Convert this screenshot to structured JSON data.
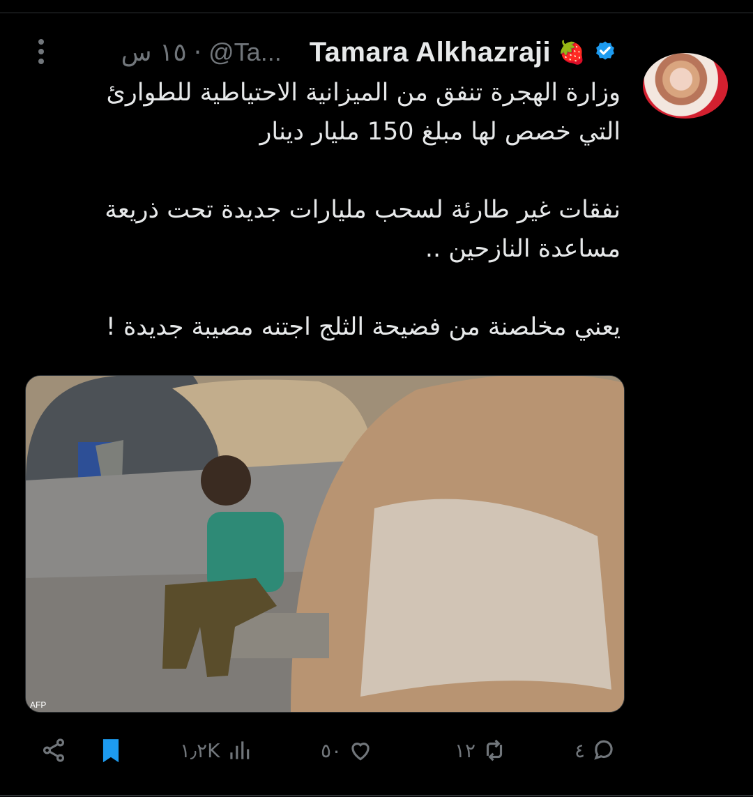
{
  "tweet": {
    "display_name": "Tamara Alkhazraji",
    "emoji": "🍓",
    "handle": "@Ta...",
    "time": "١٥ س",
    "separator": "·",
    "text": "وزارة الهجرة تنفق من الميزانية الاحتياطية للطوارئ\nالتي خصص لها مبلغ 150 مليار دينار\n\nنفقات غير طارئة لسحب مليارات جديدة تحت ذريعة\nمساعدة النازحين ..\n\nيعني مخلصنة من فضيحة الثلج اجتنه مصيبة جديدة !",
    "media_credit": "AFP"
  },
  "actions": {
    "replies": "٤",
    "retweets": "١٢",
    "likes": "٥٠",
    "views": "١٫٢K"
  },
  "colors": {
    "background": "#000000",
    "text": "#e7e9ea",
    "muted": "#71767b",
    "verified": "#1d9bf0",
    "bookmark": "#1d9bf0"
  },
  "icons": {
    "more": "more-vertical-icon",
    "verified": "verified-badge-icon",
    "reply": "reply-icon",
    "retweet": "retweet-icon",
    "like": "heart-icon",
    "views": "analytics-icon",
    "bookmark": "bookmark-icon",
    "share": "share-icon"
  }
}
